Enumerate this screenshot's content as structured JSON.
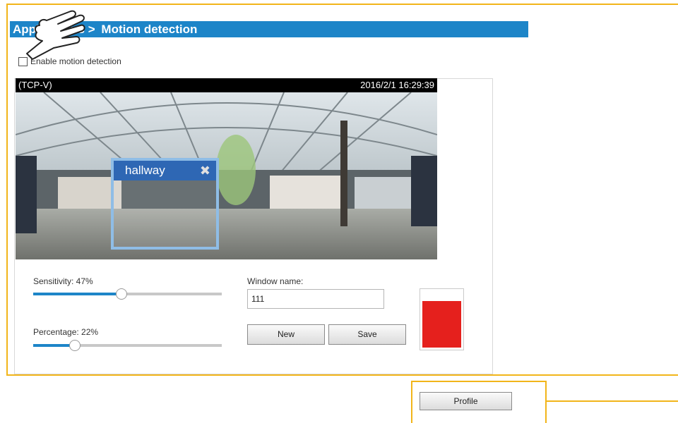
{
  "header": {
    "breadcrumb_parent": "Applications",
    "breadcrumb_separator": ">",
    "title": "Motion detection",
    "bar_color": "#1d85c8"
  },
  "enable_checkbox": {
    "label": "Enable motion detection",
    "checked": false
  },
  "video": {
    "stream_label": "(TCP-V)",
    "timestamp": "2016/2/1 16:29:39"
  },
  "motion_window": {
    "name": "hallway",
    "close_icon": "close-x-icon"
  },
  "sensitivity": {
    "label": "Sensitivity: 47%",
    "value_percent": 47
  },
  "percentage": {
    "label": "Percentage: 22%",
    "value_percent": 22
  },
  "window_name": {
    "label": "Window name:",
    "value": "111"
  },
  "buttons": {
    "new": "New",
    "save": "Save",
    "profile": "Profile"
  },
  "alert_meter": {
    "level_percent": 84,
    "color": "#e5201d"
  },
  "colors": {
    "callout": "#f2b51a",
    "accent": "#1d85c8"
  }
}
